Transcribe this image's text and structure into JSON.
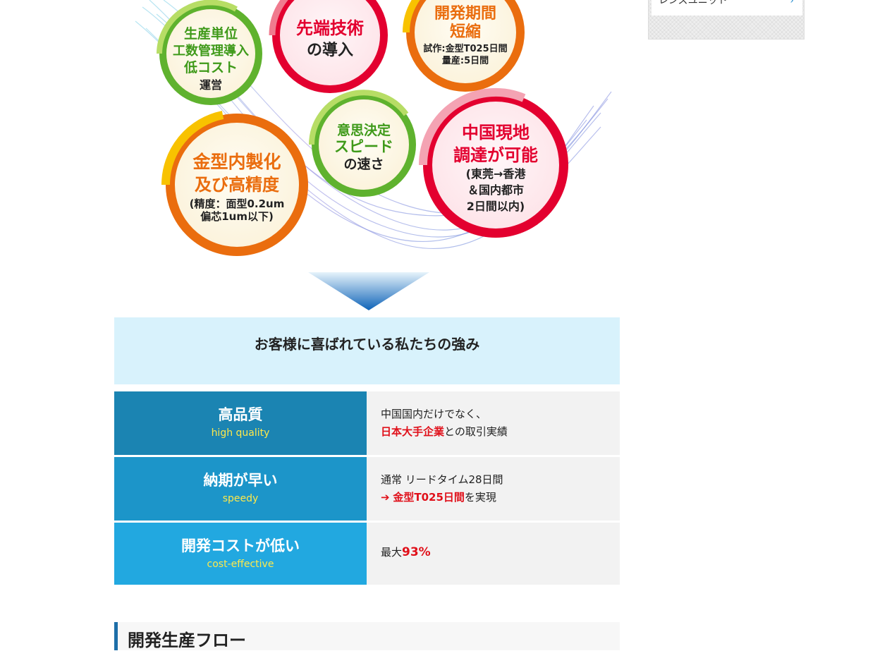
{
  "sidebar": {
    "link_label": "レンズユニット",
    "chevron_icon": "chevron-right-icon"
  },
  "hero": {
    "bubbles": [
      {
        "lines": [
          "生産単位",
          "工数管理導入",
          "低コスト",
          "運営"
        ]
      },
      {
        "lines": [
          "先端技術",
          "の導入"
        ]
      },
      {
        "lines": [
          "開発期間",
          "短縮",
          "試作:金型T025日間",
          "量産:5日間"
        ]
      },
      {
        "lines": [
          "意思決定",
          "スピード",
          "の速さ"
        ]
      },
      {
        "lines": [
          "金型内製化",
          "及び高精度",
          "(精度：面型0.2um",
          "偏芯1um以下)"
        ]
      },
      {
        "lines": [
          "中国現地",
          "調達が可能",
          "(東莞→香港",
          "＆国内都市",
          "2日間以内)"
        ]
      }
    ],
    "arrow_icon": "chevron-down-arrow-icon"
  },
  "strength": {
    "title": "お客様に喜ばれている私たちの強み"
  },
  "features": [
    {
      "label_jp": "高品質",
      "label_en": "high quality",
      "color": "#1b84b2",
      "line1": "中国国内だけでなく、",
      "line2_highlight": "日本大手企業",
      "line2_rest": "との取引実績"
    },
    {
      "label_jp": "納期が早い",
      "label_en": "speedy",
      "color": "#1c95c9",
      "line1": "通常 リードタイム28日間",
      "arrow": "➔",
      "line2_highlight": "金型T025日間",
      "line2_rest": "を実現"
    },
    {
      "label_jp": "開発コストが低い",
      "label_en": "cost-effective",
      "color": "#22a8e0",
      "prefix": "最大",
      "highlight": "93%"
    }
  ],
  "flow": {
    "heading": "開発生産フロー"
  },
  "colors": {
    "accent_blue": "#1d6ea8",
    "highlight_red": "#e0101a",
    "banner_bg": "#d8f2fc",
    "english_label_yellow": "#ffe94a"
  }
}
